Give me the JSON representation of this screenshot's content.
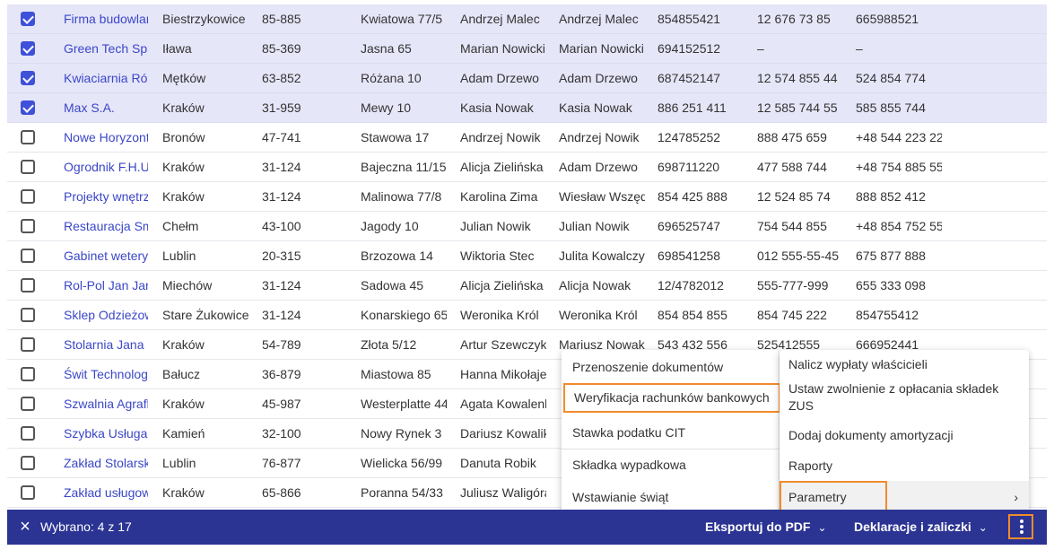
{
  "rows": [
    {
      "selected": true,
      "name": "Firma budowlana",
      "city": "Biestrzykowice",
      "zip": "85-885",
      "street": "Kwiatowa 77/5",
      "p1": "Andrzej Malec",
      "p2": "Andrzej Malec",
      "nr1": "854855421",
      "nr2": "12 676 73 85",
      "nr3": "665988521"
    },
    {
      "selected": true,
      "name": "Green Tech Sp.",
      "city": "Iława",
      "zip": "85-369",
      "street": "Jasna 65",
      "p1": "Marian Nowicki",
      "p2": "Marian Nowicki",
      "nr1": "694152512",
      "nr2": "–",
      "nr3": "–"
    },
    {
      "selected": true,
      "name": "Kwiaciarnia Róża",
      "city": "Mętków",
      "zip": "63-852",
      "street": "Różana 10",
      "p1": "Adam Drzewo",
      "p2": "Adam Drzewo",
      "nr1": "687452147",
      "nr2": "12 574 855 44",
      "nr3": "524 854 774"
    },
    {
      "selected": true,
      "name": "Max S.A.",
      "city": "Kraków",
      "zip": "31-959",
      "street": "Mewy 10",
      "p1": "Kasia Nowak",
      "p2": "Kasia Nowak",
      "nr1": "886 251 411",
      "nr2": "12 585 744 55",
      "nr3": "585 855 744"
    },
    {
      "selected": false,
      "name": "Nowe Horyzonty",
      "city": "Bronów",
      "zip": "47-741",
      "street": "Stawowa 17",
      "p1": "Andrzej Nowik",
      "p2": "Andrzej Nowik",
      "nr1": "124785252",
      "nr2": "888 475 659",
      "nr3": "+48 544 223 22"
    },
    {
      "selected": false,
      "name": "Ogrodnik F.H.U.",
      "city": "Kraków",
      "zip": "31-124",
      "street": "Bajeczna 11/15",
      "p1": "Alicja Zielińska",
      "p2": "Adam Drzewo",
      "nr1": "698711220",
      "nr2": "477 588 744",
      "nr3": "+48 754 885 55"
    },
    {
      "selected": false,
      "name": "Projekty wnętrz",
      "city": "Kraków",
      "zip": "31-124",
      "street": "Malinowa 77/8",
      "p1": "Karolina Zima",
      "p2": "Wiesław Wszęd",
      "nr1": "854 425 888",
      "nr2": "12 524 85 74",
      "nr3": "888 852 412"
    },
    {
      "selected": false,
      "name": "Restauracja Smak",
      "city": "Chełm",
      "zip": "43-100",
      "street": "Jagody 10",
      "p1": "Julian Nowik",
      "p2": "Julian Nowik",
      "nr1": "696525747",
      "nr2": "754 544 855",
      "nr3": "+48 854 752 55"
    },
    {
      "selected": false,
      "name": "Gabinet weterynaryjny",
      "city": "Lublin",
      "zip": "20-315",
      "street": "Brzozowa 14",
      "p1": "Wiktoria Stec",
      "p2": "Julita Kowalczyk",
      "nr1": "698541258",
      "nr2": "012 555-55-45",
      "nr3": "675 877 888"
    },
    {
      "selected": false,
      "name": "Rol-Pol Jan Jarek",
      "city": "Miechów",
      "zip": "31-124",
      "street": "Sadowa 45",
      "p1": "Alicja Zielińska",
      "p2": "Alicja Nowak",
      "nr1": "12/4782012",
      "nr2": "555-777-999",
      "nr3": "655 333 098"
    },
    {
      "selected": false,
      "name": "Sklep Odzieżowy",
      "city": "Stare Żukowice",
      "zip": "31-124",
      "street": "Konarskiego 65",
      "p1": "Weronika Król",
      "p2": "Weronika Król",
      "nr1": "854 854 855",
      "nr2": "854 745 222",
      "nr3": "854755412"
    },
    {
      "selected": false,
      "name": "Stolarnia Jana",
      "city": "Kraków",
      "zip": "54-789",
      "street": "Złota 5/12",
      "p1": "Artur Szewczyk",
      "p2": "Mariusz Nowak",
      "nr1": "543 432 556",
      "nr2": "525412555",
      "nr3": "666952441"
    },
    {
      "selected": false,
      "name": "Świt Technologie",
      "city": "Bałucz",
      "zip": "36-879",
      "street": "Miastowa 85",
      "p1": "Hanna Mikołajewska",
      "p2": "",
      "nr1": "",
      "nr2": "",
      "nr3": ""
    },
    {
      "selected": false,
      "name": "Szwalnia Agrafka",
      "city": "Kraków",
      "zip": "45-987",
      "street": "Westerplatte 44",
      "p1": "Agata Kowalenko",
      "p2": "",
      "nr1": "",
      "nr2": "",
      "nr3": ""
    },
    {
      "selected": false,
      "name": "Szybka Usługa",
      "city": "Kamień",
      "zip": "32-100",
      "street": "Nowy Rynek 3",
      "p1": "Dariusz Kowalik",
      "p2": "",
      "nr1": "",
      "nr2": "",
      "nr3": ""
    },
    {
      "selected": false,
      "name": "Zakład Stolarski",
      "city": "Lublin",
      "zip": "76-877",
      "street": "Wielicka 56/99",
      "p1": "Danuta Robik",
      "p2": "",
      "nr1": "",
      "nr2": "",
      "nr3": ""
    },
    {
      "selected": false,
      "name": "Zakład usługowy",
      "city": "Kraków",
      "zip": "65-866",
      "street": "Poranna 54/33",
      "p1": "Juliusz Waligóra",
      "p2": "",
      "nr1": "",
      "nr2": "",
      "nr3": ""
    }
  ],
  "bottombar": {
    "close_icon": "×",
    "selection": "Wybrano: 4 z 17",
    "export_pdf": "Eksportuj do PDF",
    "declarations": "Deklaracje i zaliczki",
    "chevron": "⌄",
    "kebab_icon": "more-vertical-icon",
    "accent": "#f28b2c",
    "bar_color": "#2b3493"
  },
  "menu_left": {
    "items": [
      "Przenoszenie dokumentów",
      "Weryfikacja rachunków bankowych",
      "Stawka podatku CIT",
      "Składka wypadkowa",
      "Wstawianie świąt"
    ]
  },
  "menu_right": {
    "items": [
      "Nalicz wypłaty właścicieli",
      "Ustaw zwolnienie z opłacania składek ZUS",
      "Dodaj dokumenty amortyzacji",
      "Raporty",
      "Parametry"
    ],
    "submenu_arrow": "›"
  }
}
